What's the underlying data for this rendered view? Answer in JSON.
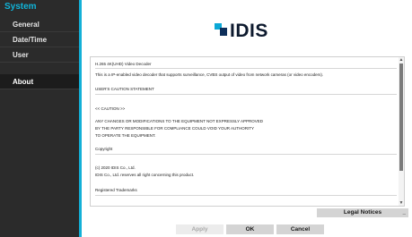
{
  "sidebar": {
    "title": "System",
    "items": [
      {
        "label": "General"
      },
      {
        "label": "Date/Time"
      },
      {
        "label": "User"
      },
      {
        "label": "About"
      }
    ],
    "active_item": "About"
  },
  "logo": {
    "text": "IDIS"
  },
  "document": {
    "lines": [
      "H.265 4K(UHD) Video Decoder",
      "This is a IP-enabled video decoder that supports surveillance, CVBS output of video from network cameras (or video encoders).",
      "USER'S CAUTION STATEMENT",
      "<< CAUTION >>",
      "ANY CHANGES OR MODIFICATIONS TO THE EQUIPMENT NOT EXPRESSLY APPROVED",
      "BY THE PARTY RESPONSIBLE FOR COMPLIANCE COULD VOID YOUR AUTHORITY",
      "TO OPERATE THE EQUIPMENT.",
      "Copyright",
      "(c) 2020 IDIS Co., Ltd.",
      "IDIS Co., Ltd. reserves all right concerning this product.",
      "Registered Trademarks"
    ]
  },
  "buttons": {
    "legal_notices": "Legal Notices",
    "apply": "Apply",
    "ok": "OK",
    "cancel": "Cancel"
  },
  "colors": {
    "accent": "#13b0d7",
    "sidebar_bg": "#2b2b2b",
    "logo_light": "#0ba8d6",
    "logo_dark": "#0d2f5a"
  }
}
